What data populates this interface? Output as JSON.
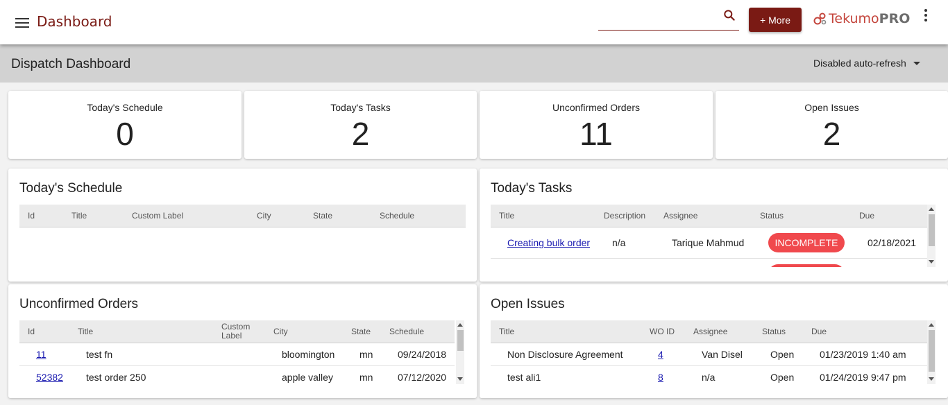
{
  "header": {
    "app_title": "Dashboard",
    "search_placeholder": "",
    "more_button": "+ More",
    "logo_text_1": "Tekumo",
    "logo_text_2": "PRO",
    "brand_color": "#7a1a14"
  },
  "page": {
    "title": "Dispatch Dashboard",
    "refresh_selector": "Disabled auto-refresh"
  },
  "stats": [
    {
      "label": "Today's Schedule",
      "value": "0"
    },
    {
      "label": "Today's Tasks",
      "value": "2"
    },
    {
      "label": "Unconfirmed Orders",
      "value": "11"
    },
    {
      "label": "Open Issues",
      "value": "2"
    }
  ],
  "schedule": {
    "title": "Today's Schedule",
    "columns": [
      "Id",
      "Title",
      "Custom Label",
      "City",
      "State",
      "Schedule"
    ],
    "rows": []
  },
  "tasks": {
    "title": "Today's Tasks",
    "columns": [
      "Title",
      "Description",
      "Assignee",
      "Status",
      "Due"
    ],
    "rows": [
      {
        "title": "Creating bulk order",
        "description": "n/a",
        "assignee": "Tarique Mahmud",
        "status": "INCOMPLETE",
        "due": "02/18/2021"
      }
    ],
    "status_color": "#f0494d"
  },
  "orders": {
    "title": "Unconfirmed Orders",
    "columns": [
      "Id",
      "Title",
      "Custom Label",
      "City",
      "State",
      "Schedule"
    ],
    "rows": [
      {
        "id": "11",
        "title": "test fn",
        "custom_label": "",
        "city": "bloomington",
        "state": "mn",
        "schedule": "09/24/2018"
      },
      {
        "id": "52382",
        "title": "test order 250",
        "custom_label": "",
        "city": "apple valley",
        "state": "mn",
        "schedule": "07/12/2020"
      }
    ]
  },
  "issues": {
    "title": "Open Issues",
    "columns": [
      "Title",
      "WO ID",
      "Assignee",
      "Status",
      "Due"
    ],
    "rows": [
      {
        "title": "Non Disclosure Agreement",
        "wo_id": "4",
        "assignee": "Van Disel",
        "status": "Open",
        "due": "01/23/2019 1:40 am"
      },
      {
        "title": "test ali1",
        "wo_id": "8",
        "assignee": "n/a",
        "status": "Open",
        "due": "01/24/2019 9:47 pm"
      }
    ]
  }
}
